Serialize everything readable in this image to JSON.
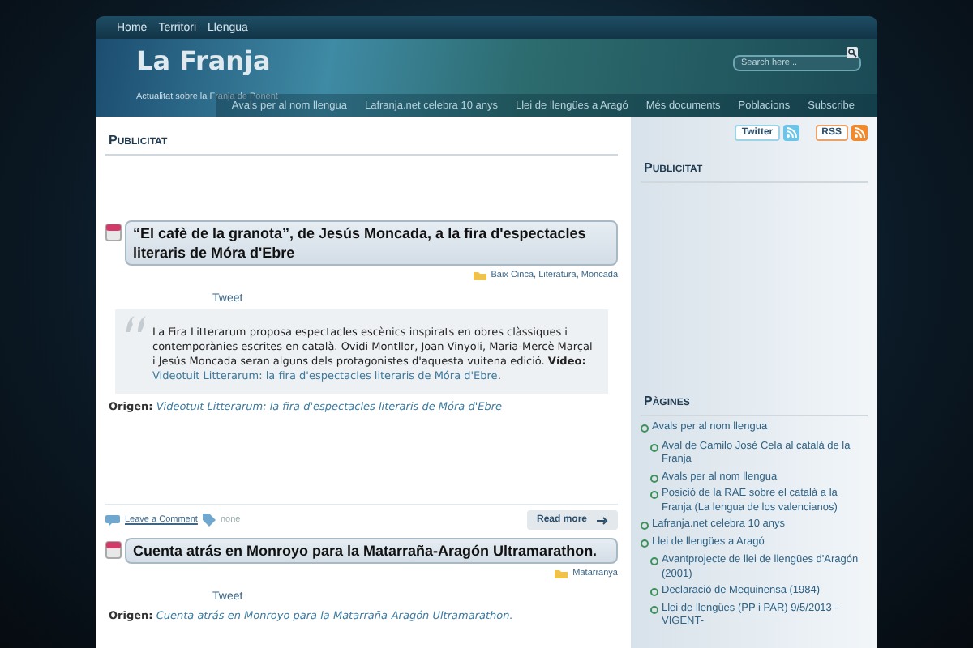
{
  "top_nav": [
    "Home",
    "Territori",
    "Llengua"
  ],
  "header": {
    "logo": "La Franja",
    "tagline": "Actualitat sobre la Franja de Ponent",
    "search": {
      "placeholder": "Search here..."
    },
    "menu": [
      "Avals per al nom llengua",
      "Lafranja.net celebra 10 anys",
      "Llei de llengües a Aragó",
      "Més documents",
      "Poblacions",
      "Subscribe"
    ]
  },
  "main": {
    "heading": "Publicitat",
    "posts": [
      {
        "title": "“El cafè de la granota”, de Jesús Moncada, a la fira d'espectacles literaris de Móra d'Ebre",
        "categories": "Baix Cinca, Literatura, Moncada",
        "tweet": "Tweet",
        "quote": {
          "text": "La Fira Litterarum proposa espectacles escènics inspirats en obres clàssiques i contemporànies escrites en català. Ovidi Montllor, Joan Vinyoli, Maria-Mercè Marçal i Jesús Moncada seran alguns dels protagonistes d'aquesta vuitena edició.",
          "video_label": "Vídeo:",
          "video_link": "Videotuit Litterarum: la fira d'espectacles literaris de Móra d'Ebre",
          "video_end": "."
        },
        "origin_label": "Origen:",
        "origin_link": "Videotuit Litterarum: la fira d'espectacles literaris de Móra d'Ebre",
        "footer": {
          "comment": "Leave a Comment",
          "tags": "none",
          "read_more": "Read more"
        }
      },
      {
        "title": "Cuenta atrás en Monroyo para la Matarraña-Aragón Ultramarathon.",
        "categories": "Matarranya",
        "tweet": "Tweet",
        "origin_label": "Origen:",
        "origin_link": "Cuenta atrás en Monroyo para la Matarraña-Aragón Ultramarathon."
      }
    ]
  },
  "sidebar": {
    "social": [
      "Twitter",
      "RSS"
    ],
    "ad_heading": "Publicitat",
    "pages_heading": "Pàgines",
    "pages": [
      {
        "label": "Avals per al nom llengua",
        "children": [
          {
            "label": "Aval de Camilo José Cela al català de la Franja"
          },
          {
            "label": "Avals per al nom llengua"
          },
          {
            "label": "Posició de la RAE sobre el català a la Franja (La lengua de los valencianos)"
          }
        ]
      },
      {
        "label": "Lafranja.net celebra 10 anys"
      },
      {
        "label": "Llei de llengües a Aragó",
        "children": [
          {
            "label": "Avantprojecte de llei de llengües d'Aragón (2001)"
          },
          {
            "label": "Declaració de Mequinensa (1984)"
          },
          {
            "label": "Llei de llengües (PP i PAR) 9/5/2013 - VIGENT-"
          }
        ]
      }
    ]
  }
}
